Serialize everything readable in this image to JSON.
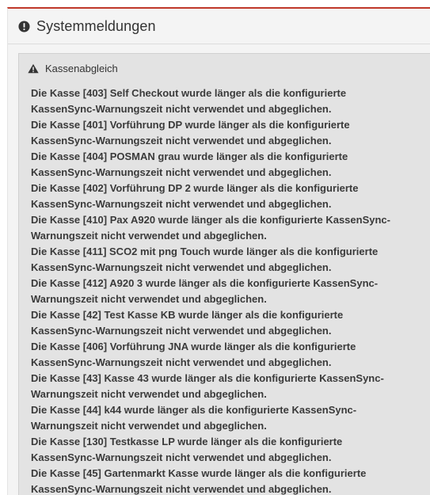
{
  "panel": {
    "title": "Systemmeldungen",
    "icon": "exclamation-circle-icon",
    "accent_color": "#c0392b"
  },
  "alert": {
    "title": "Kassenabgleich",
    "icon": "warning-triangle-icon",
    "messages": [
      "Die Kasse [403] Self Checkout wurde länger als die konfigurierte KassenSync-Warnungszeit nicht verwendet und abgeglichen.",
      "Die Kasse [401] Vorführung DP wurde länger als die konfigurierte KassenSync-Warnungszeit nicht verwendet und abgeglichen.",
      "Die Kasse [404] POSMAN grau wurde länger als die konfigurierte KassenSync-Warnungszeit nicht verwendet und abgeglichen.",
      "Die Kasse [402] Vorführung DP 2 wurde länger als die konfigurierte KassenSync-Warnungszeit nicht verwendet und abgeglichen.",
      "Die Kasse [410] Pax A920 wurde länger als die konfigurierte KassenSync-Warnungszeit nicht verwendet und abgeglichen.",
      "Die Kasse [411] SCO2 mit png Touch wurde länger als die konfigurierte KassenSync-Warnungszeit nicht verwendet und abgeglichen.",
      "Die Kasse [412] A920 3 wurde länger als die konfigurierte KassenSync-Warnungszeit nicht verwendet und abgeglichen.",
      "Die Kasse [42] Test Kasse KB wurde länger als die konfigurierte KassenSync-Warnungszeit nicht verwendet und abgeglichen.",
      "Die Kasse [406] Vorführung JNA wurde länger als die konfigurierte KassenSync-Warnungszeit nicht verwendet und abgeglichen.",
      "Die Kasse [43] Kasse 43 wurde länger als die konfigurierte KassenSync-Warnungszeit nicht verwendet und abgeglichen.",
      "Die Kasse [44] k44 wurde länger als die konfigurierte KassenSync-Warnungszeit nicht verwendet und abgeglichen.",
      "Die Kasse [130] Testkasse LP wurde länger als die konfigurierte KassenSync-Warnungszeit nicht verwendet und abgeglichen.",
      "Die Kasse [45] Gartenmarkt Kasse wurde länger als die konfigurierte KassenSync-Warnungszeit nicht verwendet und abgeglichen."
    ]
  }
}
